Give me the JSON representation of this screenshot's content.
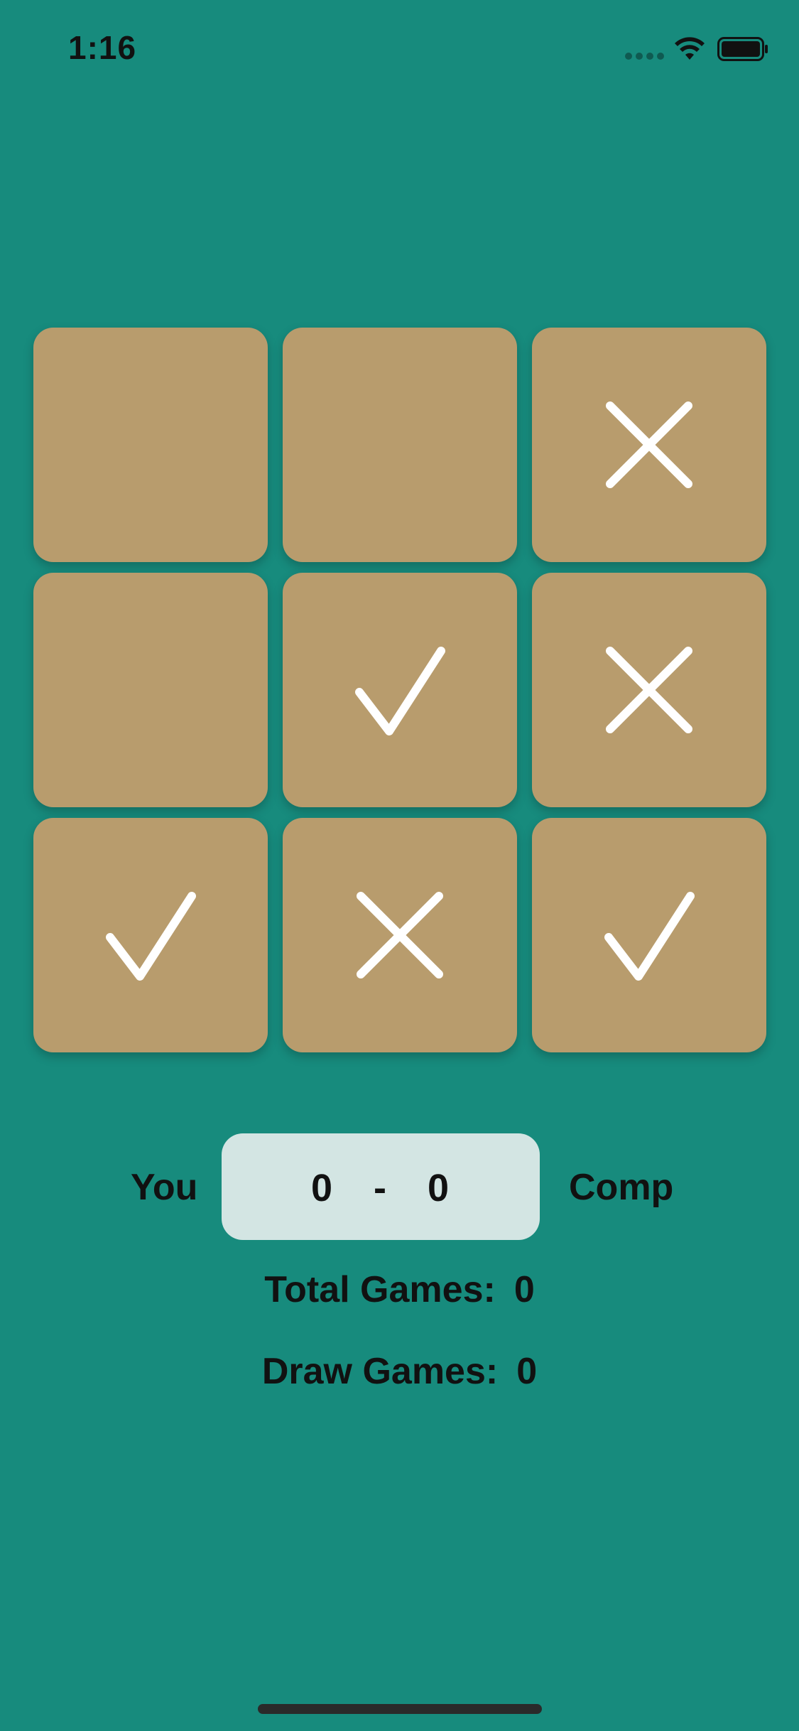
{
  "status_bar": {
    "time": "1:16",
    "wifi_icon": "wifi-icon",
    "battery_icon": "battery-icon"
  },
  "board": {
    "cells": [
      {
        "mark": ""
      },
      {
        "mark": ""
      },
      {
        "mark": "x"
      },
      {
        "mark": ""
      },
      {
        "mark": "check"
      },
      {
        "mark": "x"
      },
      {
        "mark": "check"
      },
      {
        "mark": "x"
      },
      {
        "mark": "check"
      }
    ]
  },
  "score": {
    "you_label": "You",
    "comp_label": "Comp",
    "you": "0",
    "separator": "-",
    "comp": "0"
  },
  "stats": {
    "total_label": "Total Games:",
    "total_value": "0",
    "draw_label": "Draw Games:",
    "draw_value": "0"
  },
  "colors": {
    "background": "#178b7d",
    "cell": "#b89c6d",
    "mark": "#ffffff",
    "score_box": "#d3e5e3"
  }
}
